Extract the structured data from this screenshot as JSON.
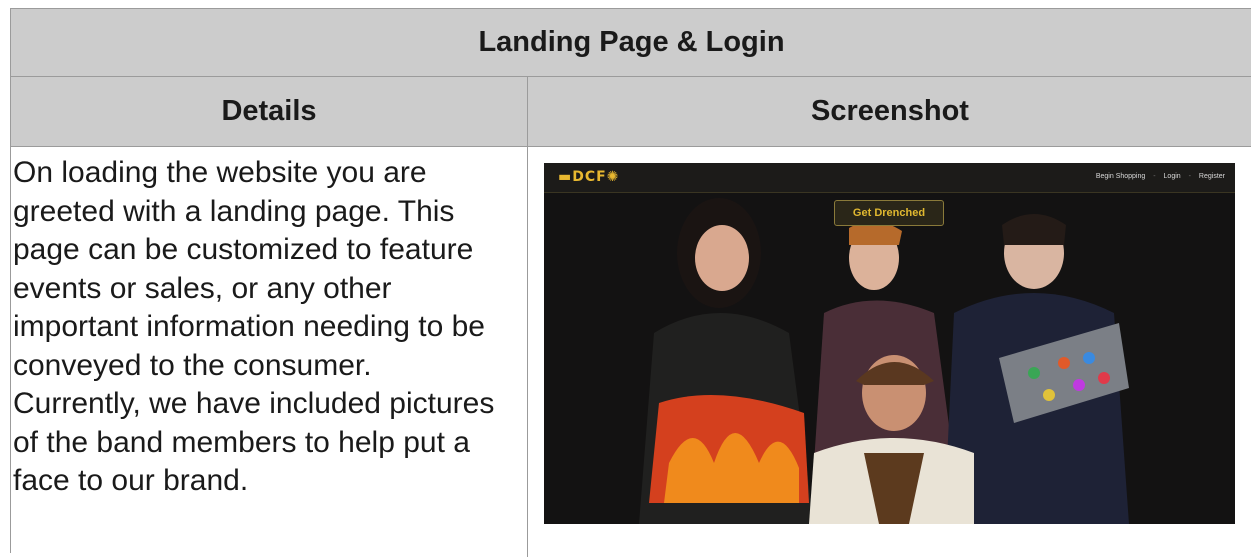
{
  "table": {
    "title": "Landing Page & Login",
    "col_details": "Details",
    "col_screenshot": "Screenshot",
    "details_text": "On loading the website you are greeted with a landing page. This page can be customized to feature events or sales, or any other important information needing to be conveyed to the consumer. Currently, we have included pictures of the band members to help put a face to our brand."
  },
  "screenshot": {
    "logo": "▬DCF✺",
    "nav_links": [
      "Begin Shopping",
      "Login",
      "Register"
    ],
    "nav_sep": "-",
    "cta": "Get Drenched",
    "colors": {
      "background": "#131212",
      "accent": "#e0b830"
    }
  }
}
